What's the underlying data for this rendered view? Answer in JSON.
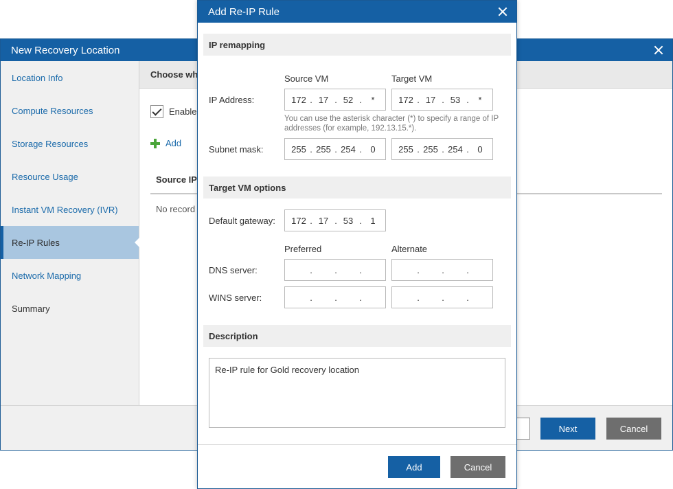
{
  "wizard": {
    "title": "New Recovery Location",
    "steps": [
      {
        "label": "Location Info"
      },
      {
        "label": "Compute Resources"
      },
      {
        "label": "Storage Resources"
      },
      {
        "label": "Resource Usage"
      },
      {
        "label": "Instant VM Recovery (IVR)"
      },
      {
        "label": "Re-IP Rules"
      },
      {
        "label": "Network Mapping"
      },
      {
        "label": "Summary"
      }
    ],
    "active_step": "Re-IP Rules",
    "header_text": "Choose wh",
    "enable_label": "Enable",
    "add_label": "Add",
    "grid_column": "Source IP",
    "no_records": "No record",
    "next_label": "Next",
    "cancel_label": "Cancel"
  },
  "dialog": {
    "title": "Add Re-IP Rule",
    "ip_remapping": {
      "section_title": "IP remapping",
      "source_header": "Source VM",
      "target_header": "Target VM",
      "ip_address_label": "IP Address:",
      "source_ip": [
        "172",
        "17",
        "52",
        "*"
      ],
      "target_ip": [
        "172",
        "17",
        "53",
        "*"
      ],
      "hint": "You can use the asterisk character (*) to specify a range of IP addresses (for example, 192.13.15.*).",
      "subnet_label": "Subnet mask:",
      "source_subnet": [
        "255",
        "255",
        "254",
        "0"
      ],
      "target_subnet": [
        "255",
        "255",
        "254",
        "0"
      ]
    },
    "target_options": {
      "section_title": "Target VM options",
      "gateway_label": "Default gateway:",
      "gateway": [
        "172",
        "17",
        "53",
        "1"
      ],
      "preferred_header": "Preferred",
      "alternate_header": "Alternate",
      "dns_label": "DNS server:",
      "wins_label": "WINS server:",
      "dns_preferred": [
        "",
        "",
        "",
        ""
      ],
      "dns_alternate": [
        "",
        "",
        "",
        ""
      ],
      "wins_preferred": [
        "",
        "",
        "",
        ""
      ],
      "wins_alternate": [
        "",
        "",
        "",
        ""
      ]
    },
    "description": {
      "section_title": "Description",
      "value": "Re-IP rule for Gold recovery location"
    },
    "add_label": "Add",
    "cancel_label": "Cancel"
  },
  "colors": {
    "titlebar": "#1560a4",
    "primary_button": "#1560a4",
    "secondary_button": "#6e6e6e",
    "active_step_bg": "#a9c6e0",
    "link": "#1a6aaa",
    "add_icon": "#4aa53a"
  },
  "icons": [
    "close-icon",
    "checkbox-checked-icon",
    "plus-icon"
  ]
}
